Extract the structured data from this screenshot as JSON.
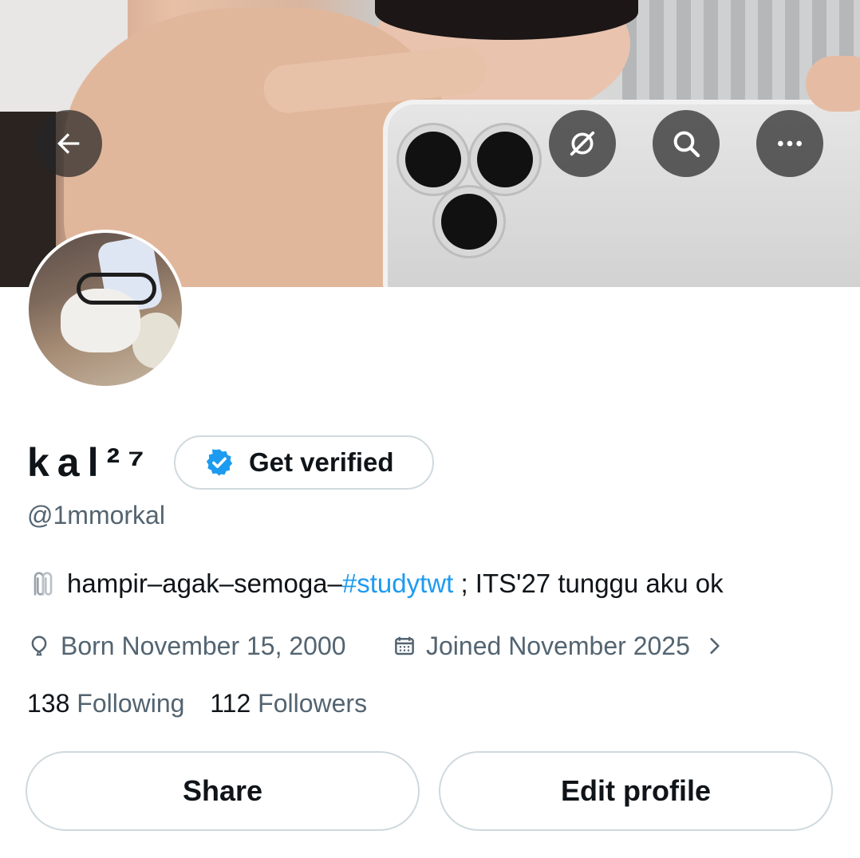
{
  "header": {
    "back_icon": "arrow-left-icon",
    "grok_icon": "grok-icon",
    "search_icon": "search-icon",
    "more_icon": "more-horizontal-icon"
  },
  "profile": {
    "display_name": "kal²⁷",
    "handle": "@1mmorkal",
    "get_verified_label": "Get verified",
    "bio": {
      "emoji": "paperclips-emoji",
      "prefix": "hampir–agak–semoga–",
      "hashtag": "#studytwt",
      "suffix": " ; ITS'27 tunggu aku ok"
    },
    "born": "Born November 15, 2000",
    "joined": "Joined November 2025",
    "following_count": "138",
    "following_label": "Following",
    "followers_count": "112",
    "followers_label": "Followers"
  },
  "actions": {
    "share_label": "Share",
    "edit_label": "Edit profile"
  },
  "colors": {
    "link": "#1d9bf0",
    "secondary_text": "#536471",
    "border": "#cfd9de"
  }
}
